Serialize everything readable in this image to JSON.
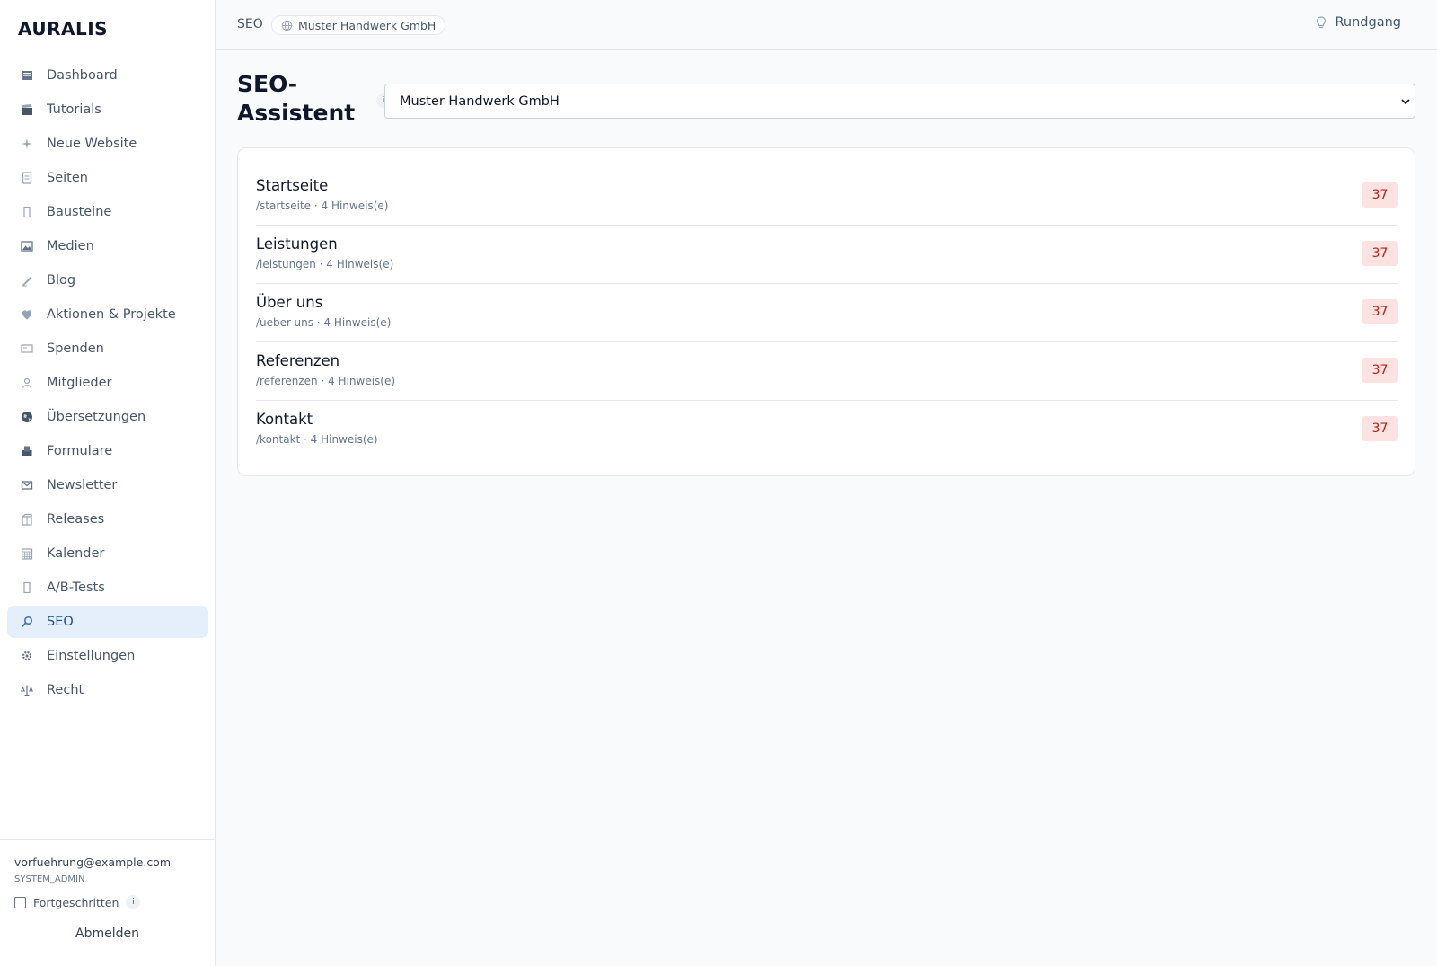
{
  "app": {
    "brand": "AURALIS"
  },
  "sidebar": {
    "items": [
      {
        "label": "Dashboard",
        "icon": "dashboard-icon"
      },
      {
        "label": "Tutorials",
        "icon": "clapperboard-icon"
      },
      {
        "label": "Neue Website",
        "icon": "sparkle-icon"
      },
      {
        "label": "Seiten",
        "icon": "document-icon"
      },
      {
        "label": "Bausteine",
        "icon": "block-icon"
      },
      {
        "label": "Medien",
        "icon": "image-icon"
      },
      {
        "label": "Blog",
        "icon": "pen-icon"
      },
      {
        "label": "Aktionen & Projekte",
        "icon": "heart-icon"
      },
      {
        "label": "Spenden",
        "icon": "card-icon"
      },
      {
        "label": "Mitglieder",
        "icon": "people-icon"
      },
      {
        "label": "Übersetzungen",
        "icon": "globe-icon"
      },
      {
        "label": "Formulare",
        "icon": "ballot-icon"
      },
      {
        "label": "Newsletter",
        "icon": "mail-icon"
      },
      {
        "label": "Releases",
        "icon": "package-icon"
      },
      {
        "label": "Kalender",
        "icon": "calendar-icon"
      },
      {
        "label": "A/B-Tests",
        "icon": "split-icon"
      },
      {
        "label": "SEO",
        "icon": "search-icon"
      },
      {
        "label": "Einstellungen",
        "icon": "gear-icon"
      },
      {
        "label": "Recht",
        "icon": "scales-icon"
      }
    ],
    "active": "SEO",
    "footer": {
      "email": "vorfuehrung@example.com",
      "role": "SYSTEM_ADMIN",
      "advanced_label": "Fortgeschritten",
      "advanced_checked": false,
      "info": "i",
      "logout_label": "Abmelden"
    }
  },
  "topbar": {
    "breadcrumb": "SEO",
    "site": "Muster Handwerk GmbH",
    "tour_label": "Rundgang"
  },
  "main": {
    "title": "SEO-Assistent",
    "title_info": "i",
    "site_select": {
      "value": "Muster Handwerk GmbH"
    },
    "pages": [
      {
        "title": "Startseite",
        "meta": "/startseite · 4 Hinweis(e)",
        "score": "37"
      },
      {
        "title": "Leistungen",
        "meta": "/leistungen · 4 Hinweis(e)",
        "score": "37"
      },
      {
        "title": "Über uns",
        "meta": "/ueber-uns · 4 Hinweis(e)",
        "score": "37"
      },
      {
        "title": "Referenzen",
        "meta": "/referenzen · 4 Hinweis(e)",
        "score": "37"
      },
      {
        "title": "Kontakt",
        "meta": "/kontakt · 4 Hinweis(e)",
        "score": "37"
      }
    ]
  },
  "colors": {
    "accent_bg": "#e5eefb",
    "accent_text": "#1e4f8f",
    "score_bg": "#fde2e2",
    "score_text": "#b42318"
  }
}
